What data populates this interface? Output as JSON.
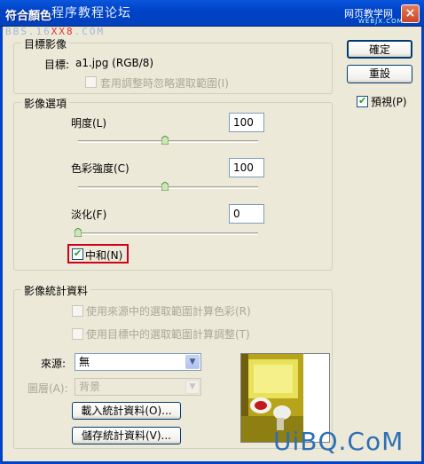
{
  "window": {
    "title": "符合顏色",
    "close_glyph": "×",
    "watermark_cn": "程序教程论坛",
    "watermark_url_pre": "BBS.16",
    "watermark_url_red": "XX8",
    "watermark_url_post": ".COM",
    "watermark_site_cn": "网页教学网",
    "watermark_site_en": "WEBJX.COM",
    "watermark_bottom": "UiBQ.CoM"
  },
  "target_image": {
    "legend": "目標影像",
    "target_label": "目標:",
    "target_value": "a1.jpg (RGB/8)",
    "ignore_selection_label": "套用調整時忽略選取範圍(I)",
    "ignore_selection_checked": false
  },
  "image_options": {
    "legend": "影像選項",
    "luminance_label": "明度(L)",
    "luminance_value": "100",
    "luminance_slider": 0.5,
    "color_intensity_label": "色彩強度(C)",
    "color_intensity_value": "100",
    "color_intensity_slider": 0.5,
    "fade_label": "淡化(F)",
    "fade_value": "0",
    "fade_slider": 0.0,
    "neutralize_label": "中和(N)",
    "neutralize_checked": true
  },
  "image_statistics": {
    "legend": "影像統計資料",
    "use_source_selection_label": "使用來源中的選取範圍計算色彩(R)",
    "use_target_selection_label": "使用目標中的選取範圍計算調整(T)",
    "source_label": "來源:",
    "source_value": "無",
    "layer_label": "圖層(A):",
    "layer_value": "背景",
    "load_stats_label": "載入統計資料(O)...",
    "save_stats_label": "儲存統計資料(V)..."
  },
  "buttons": {
    "ok_label": "確定",
    "reset_label": "重設",
    "preview_label": "預視(P)",
    "preview_checked": true
  },
  "colors": {
    "titlebar": "#0043c8",
    "dialog_bg": "#ece9d8",
    "highlight": "#d0021b",
    "check_green": "#21a121"
  }
}
